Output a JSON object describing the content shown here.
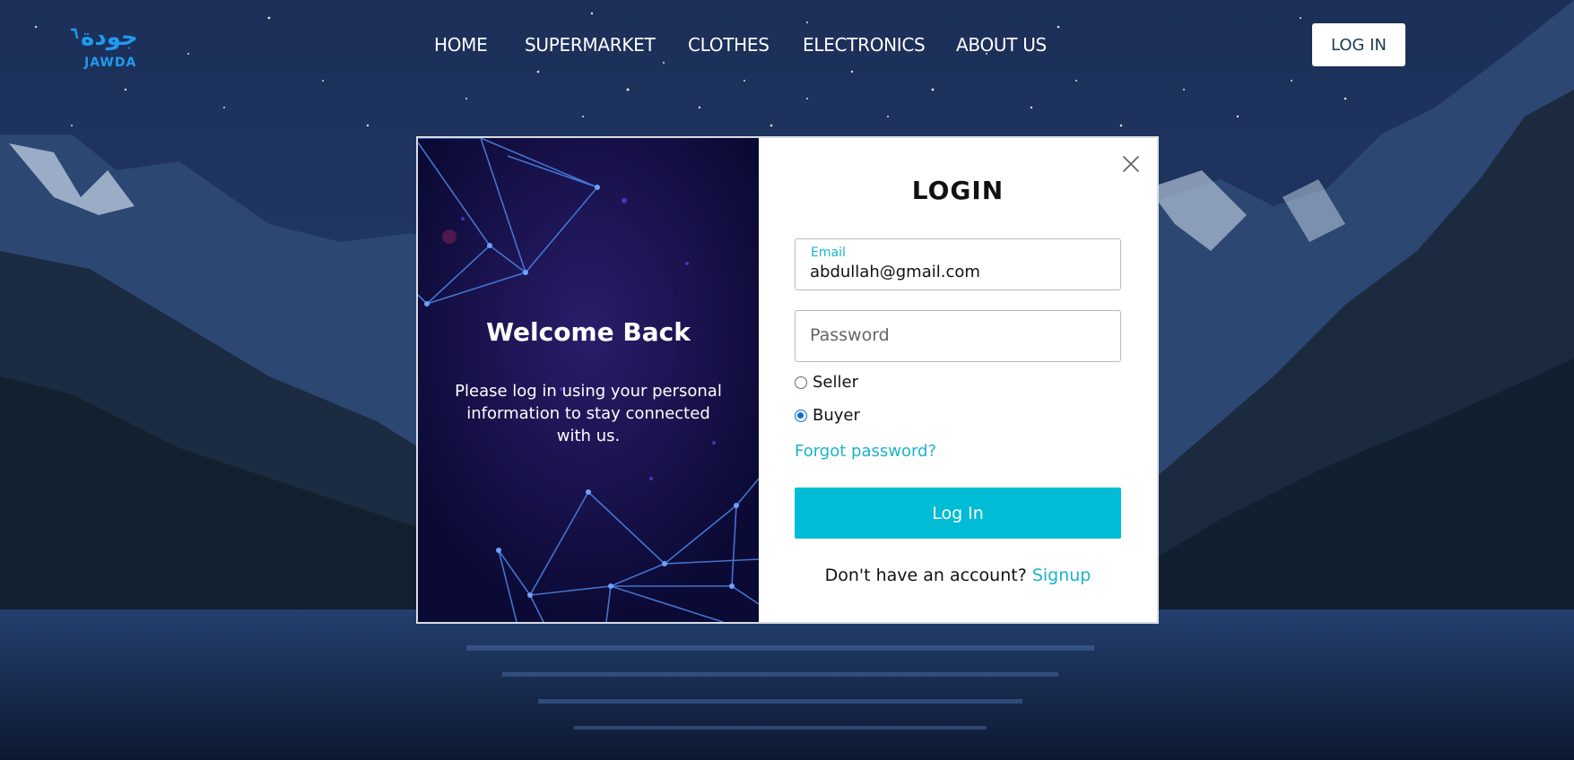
{
  "brand": {
    "name_arabic": "جودة",
    "name_latin": "JAWDA",
    "color": "#1e9bf0"
  },
  "nav": {
    "items": [
      {
        "label": "HOME"
      },
      {
        "label": "SUPERMARKET"
      },
      {
        "label": "CLOTHES"
      },
      {
        "label": "ELECTRONICS"
      },
      {
        "label": "ABOUT US"
      }
    ],
    "login_label": "LOG IN"
  },
  "modal": {
    "left": {
      "title": "Welcome Back",
      "text": "Please log in using your personal information to stay connected with us."
    },
    "right": {
      "title": "LOGIN",
      "close_icon": "close-icon",
      "email": {
        "label": "Email",
        "value": "abdullah@gmail.com"
      },
      "password": {
        "placeholder": "Password",
        "value": ""
      },
      "roles": [
        {
          "label": "Seller",
          "checked": false
        },
        {
          "label": "Buyer",
          "checked": true
        }
      ],
      "forgot_label": "Forgot password?",
      "submit_label": "Log In",
      "signup_prompt": "Don't have an account?",
      "signup_label": "Signup"
    }
  },
  "colors": {
    "accent": "#00bcd4",
    "link": "#1ab3c9",
    "panel_dark": "#0d0c3c"
  }
}
